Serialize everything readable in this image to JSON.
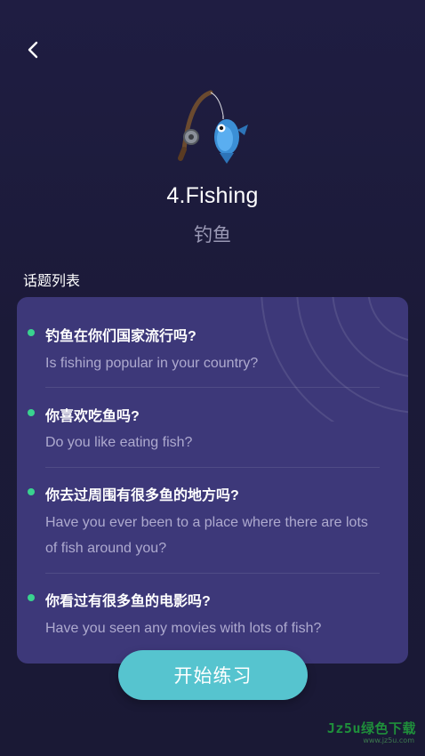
{
  "header": {
    "back_icon": "chevron-left-icon"
  },
  "hero": {
    "icon": "fishing-pole-icon"
  },
  "topic": {
    "title": "4.Fishing",
    "subtitle": "钓鱼"
  },
  "list": {
    "label": "话题列表",
    "items": [
      {
        "cn": "钓鱼在你们国家流行吗?",
        "en": "Is fishing popular in your country?"
      },
      {
        "cn": "你喜欢吃鱼吗?",
        "en": "Do you like eating fish?"
      },
      {
        "cn": "你去过周围有很多鱼的地方吗?",
        "en": "Have you ever been to a place where there are lots of fish around you?"
      },
      {
        "cn": "你看过有很多鱼的电影吗?",
        "en": "Have you seen any movies with lots of fish?"
      }
    ]
  },
  "actions": {
    "start_label": "开始练习"
  },
  "watermark": {
    "text": "Jz5u绿色下载",
    "sub": "www.jz5u.com"
  },
  "colors": {
    "background": "#1c1b3a",
    "card": "#3d3879",
    "bullet": "#39d38f",
    "button": "#56c4cf"
  }
}
